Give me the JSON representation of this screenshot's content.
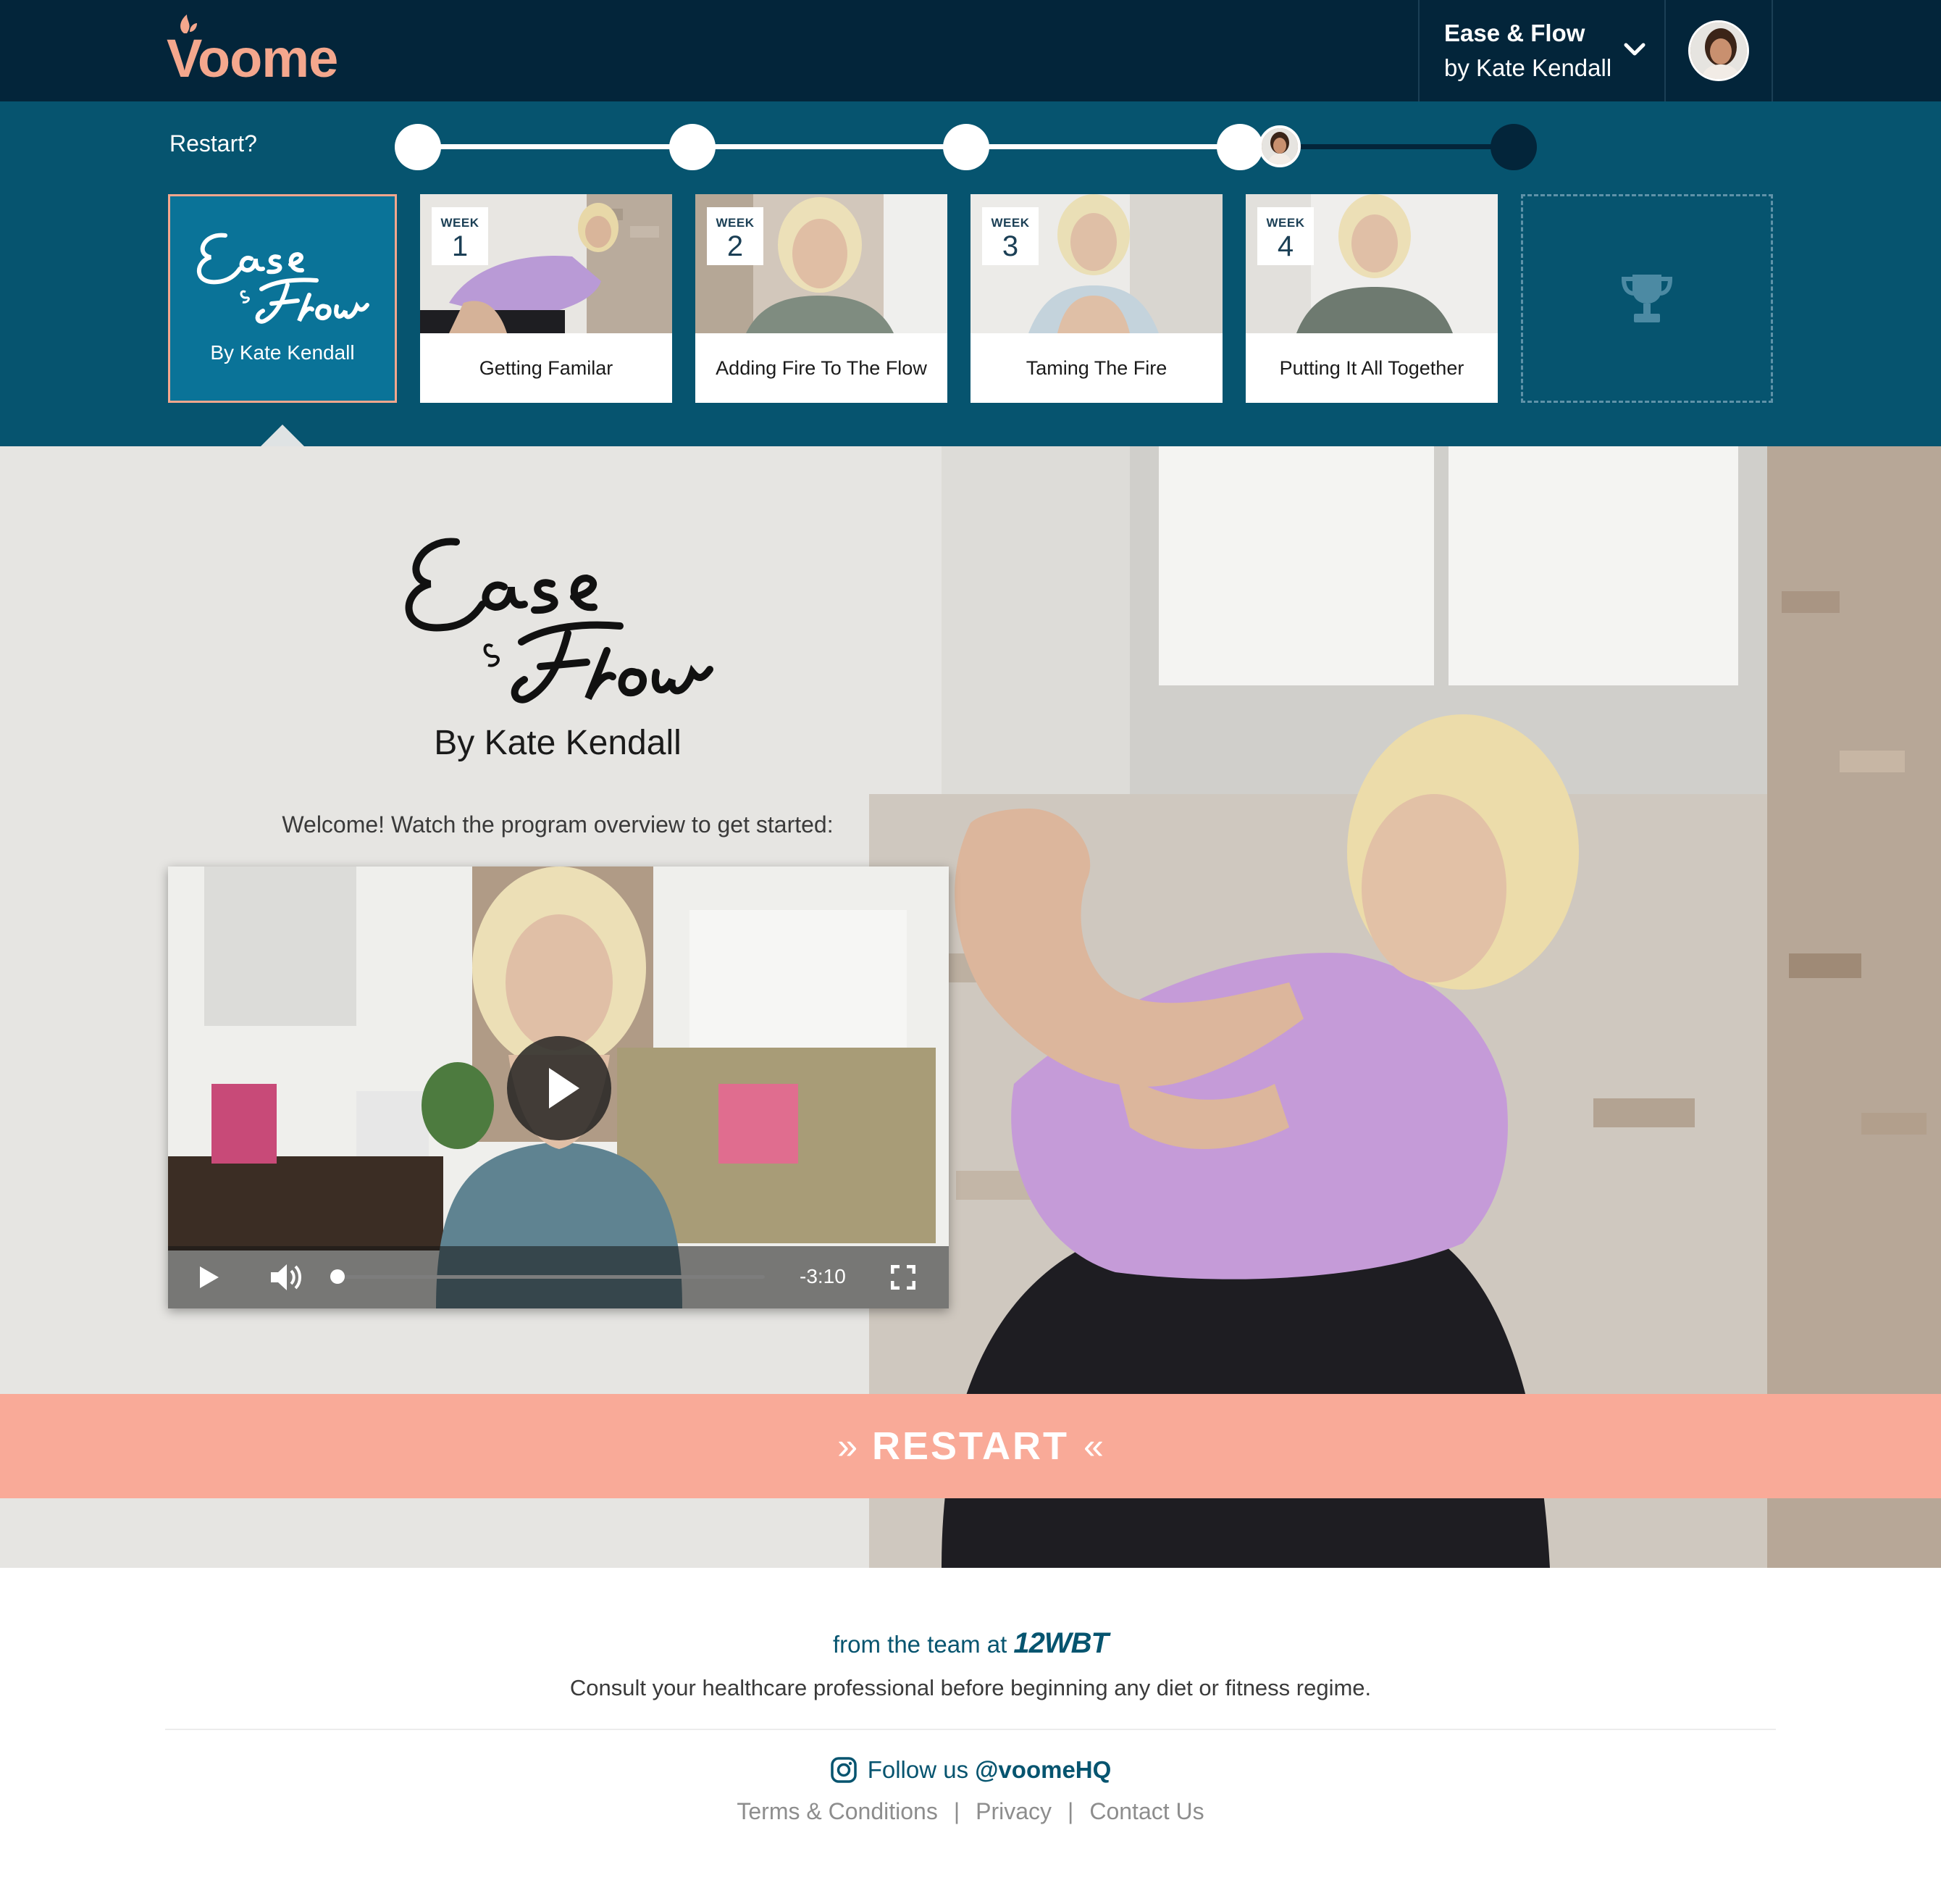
{
  "brand": {
    "name": "Voome",
    "color": "#f4a78d"
  },
  "header": {
    "program_title": "Ease & Flow",
    "program_author": "by Kate Kendall",
    "program_menu_icon": "chevron-down-icon",
    "user_avatar_icon": "user-avatar"
  },
  "progress": {
    "restart_label": "Restart?",
    "current_week": 4,
    "total_steps": 5,
    "intro_card": {
      "script_title": "Ease & Flow",
      "byline": "By Kate Kendall"
    },
    "weeks": [
      {
        "week_label": "WEEK",
        "number": "1",
        "title": "Getting Familar"
      },
      {
        "week_label": "WEEK",
        "number": "2",
        "title": "Adding Fire To The Flow"
      },
      {
        "week_label": "WEEK",
        "number": "3",
        "title": "Taming The Fire"
      },
      {
        "week_label": "WEEK",
        "number": "4",
        "title": "Putting It All Together"
      }
    ],
    "reward_icon": "trophy-icon"
  },
  "hero": {
    "script_title": "Ease & Flow",
    "byline": "By Kate Kendall",
    "welcome": "Welcome! Watch the program overview to get started:",
    "video": {
      "time_remaining": "-3:10",
      "progress": 0,
      "icons": [
        "play-icon",
        "volume-icon",
        "fullscreen-icon"
      ]
    },
    "restart_button": {
      "label": "RESTART",
      "left_glyph": "»",
      "right_glyph": "«"
    }
  },
  "footer": {
    "team_prefix": "from the team at",
    "team_brand": "12WBT",
    "disclaimer": "Consult your healthcare professional before beginning any diet or fitness regime.",
    "follow_prefix": "Follow us",
    "follow_handle": "@voomeHQ",
    "social_icon": "instagram-icon",
    "links": [
      "Terms & Conditions",
      "Privacy",
      "Contact Us"
    ],
    "link_separator": "|"
  },
  "colors": {
    "nav_dark": "#03253a",
    "band_teal": "#06546f",
    "intro_card": "#0a7398",
    "accent_peach": "#f9aa98",
    "footer_text": "#06546f"
  }
}
